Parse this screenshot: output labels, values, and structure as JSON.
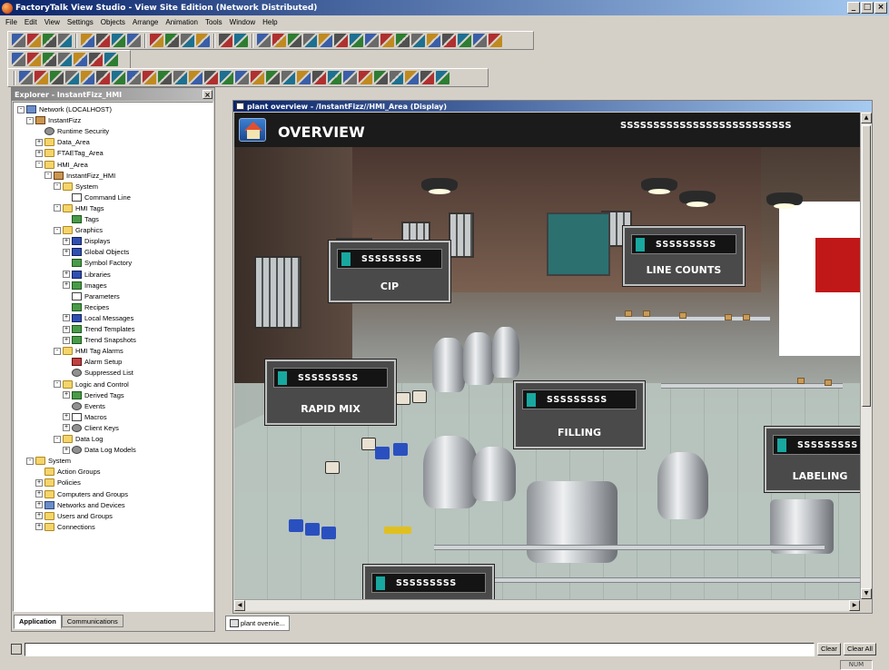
{
  "app": {
    "title": "FactoryTalk View Studio - View Site Edition (Network Distributed)",
    "window_buttons": [
      "_",
      "□",
      "×"
    ]
  },
  "menu": [
    "File",
    "Edit",
    "View",
    "Settings",
    "Objects",
    "Arrange",
    "Animation",
    "Tools",
    "Window",
    "Help"
  ],
  "explorer": {
    "title": "Explorer - InstantFizz_HMI",
    "close": "×",
    "tree": [
      {
        "label": "Network (LOCALHOST)",
        "exp": "-",
        "icon": "netico",
        "name": "tree-network"
      },
      {
        "label": "InstantFizz",
        "exp": "-",
        "icon": "appico",
        "name": "tree-instantfizz"
      },
      {
        "label": "Runtime Security",
        "exp": "",
        "icon": "gear",
        "name": "tree-runtime-security"
      },
      {
        "label": "Data_Area",
        "exp": "+",
        "icon": "folder",
        "name": "tree-data-area"
      },
      {
        "label": "FTAETag_Area",
        "exp": "+",
        "icon": "folder",
        "name": "tree-ftaetag-area"
      },
      {
        "label": "HMI_Area",
        "exp": "-",
        "icon": "folder",
        "name": "tree-hmi-area"
      },
      {
        "label": "InstantFizz_HMI",
        "exp": "-",
        "icon": "appico",
        "name": "tree-instantfizz-hmi"
      },
      {
        "label": "System",
        "exp": "-",
        "icon": "folder",
        "name": "tree-system"
      },
      {
        "label": "Command Line",
        "exp": "",
        "icon": "doc",
        "name": "tree-command-line"
      },
      {
        "label": "HMI Tags",
        "exp": "-",
        "icon": "folder",
        "name": "tree-hmi-tags"
      },
      {
        "label": "Tags",
        "exp": "",
        "icon": "green",
        "name": "tree-tags"
      },
      {
        "label": "Graphics",
        "exp": "-",
        "icon": "folder",
        "name": "tree-graphics"
      },
      {
        "label": "Displays",
        "exp": "+",
        "icon": "blue",
        "name": "tree-displays"
      },
      {
        "label": "Global Objects",
        "exp": "+",
        "icon": "blue",
        "name": "tree-global-objects"
      },
      {
        "label": "Symbol Factory",
        "exp": "",
        "icon": "green",
        "name": "tree-symbol-factory"
      },
      {
        "label": "Libraries",
        "exp": "+",
        "icon": "blue",
        "name": "tree-libraries"
      },
      {
        "label": "Images",
        "exp": "+",
        "icon": "green",
        "name": "tree-images"
      },
      {
        "label": "Parameters",
        "exp": "",
        "icon": "doc",
        "name": "tree-parameters"
      },
      {
        "label": "Recipes",
        "exp": "",
        "icon": "green",
        "name": "tree-recipes"
      },
      {
        "label": "Local Messages",
        "exp": "+",
        "icon": "blue",
        "name": "tree-local-messages"
      },
      {
        "label": "Trend Templates",
        "exp": "+",
        "icon": "green",
        "name": "tree-trend-templates"
      },
      {
        "label": "Trend Snapshots",
        "exp": "+",
        "icon": "green",
        "name": "tree-trend-snapshots"
      },
      {
        "label": "HMI Tag Alarms",
        "exp": "-",
        "icon": "folder",
        "name": "tree-hmi-tag-alarms"
      },
      {
        "label": "Alarm Setup",
        "exp": "",
        "icon": "red",
        "name": "tree-alarm-setup"
      },
      {
        "label": "Suppressed List",
        "exp": "",
        "icon": "gear",
        "name": "tree-suppressed-list"
      },
      {
        "label": "Logic and Control",
        "exp": "-",
        "icon": "folder",
        "name": "tree-logic-control"
      },
      {
        "label": "Derived Tags",
        "exp": "+",
        "icon": "green",
        "name": "tree-derived-tags"
      },
      {
        "label": "Events",
        "exp": "",
        "icon": "gear",
        "name": "tree-events"
      },
      {
        "label": "Macros",
        "exp": "+",
        "icon": "doc",
        "name": "tree-macros"
      },
      {
        "label": "Client Keys",
        "exp": "+",
        "icon": "gear",
        "name": "tree-client-keys"
      },
      {
        "label": "Data Log",
        "exp": "-",
        "icon": "folder",
        "name": "tree-data-log"
      },
      {
        "label": "Data Log Models",
        "exp": "+",
        "icon": "gear",
        "name": "tree-data-log-models"
      },
      {
        "label": "System",
        "exp": "-",
        "icon": "folder",
        "name": "tree-system-root"
      },
      {
        "label": "Action Groups",
        "exp": "",
        "icon": "folder",
        "name": "tree-action-groups"
      },
      {
        "label": "Policies",
        "exp": "+",
        "icon": "folder",
        "name": "tree-policies"
      },
      {
        "label": "Computers and Groups",
        "exp": "+",
        "icon": "folder",
        "name": "tree-computers-groups"
      },
      {
        "label": "Networks and Devices",
        "exp": "+",
        "icon": "netico",
        "name": "tree-networks-devices"
      },
      {
        "label": "Users and Groups",
        "exp": "+",
        "icon": "folder",
        "name": "tree-users-groups"
      },
      {
        "label": "Connections",
        "exp": "+",
        "icon": "folder",
        "name": "tree-connections"
      }
    ],
    "tabs": [
      "Application",
      "Communications"
    ]
  },
  "display": {
    "window_title": "plant overview - /InstantFizz//HMI_Area (Display)",
    "header_title": "OVERVIEW",
    "header_code": "SSSSSSSSSSSSSSSSSSSSSSSSSS",
    "panels": [
      {
        "label": "CIP",
        "value": "SSSSSSSSS"
      },
      {
        "label": "LINE COUNTS",
        "value": "SSSSSSSSS"
      },
      {
        "label": "RAPID MIX",
        "value": "SSSSSSSSS"
      },
      {
        "label": "FILLING",
        "value": "SSSSSSSSS"
      },
      {
        "label": "LABELING",
        "value": "SSSSSSSSS"
      },
      {
        "label": "",
        "value": "SSSSSSSSS"
      }
    ],
    "window_tab": "plant overvie..."
  },
  "diagnostics": {
    "clear": "Clear",
    "clear_all": "Clear All",
    "status": "NUM"
  }
}
